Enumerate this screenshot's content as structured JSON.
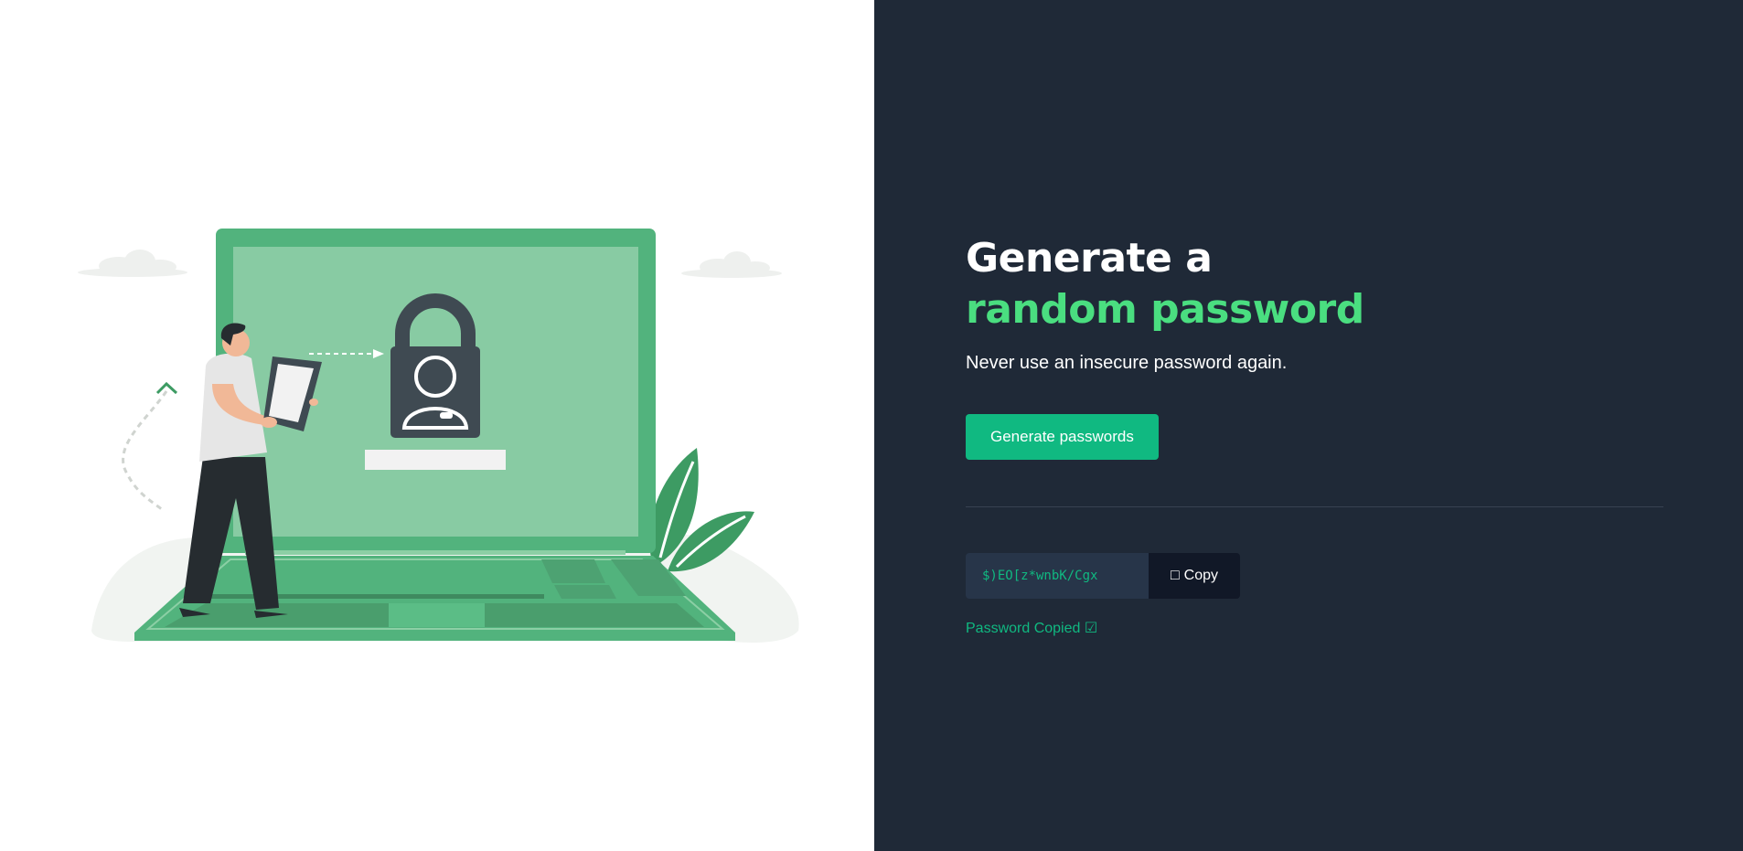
{
  "hero": {
    "title_line1": "Generate a",
    "title_line2": "random password",
    "subtitle": "Never use an insecure password again.",
    "generate_button_label": "Generate passwords"
  },
  "password": {
    "value": "$)EO[z*wnbK/Cgx",
    "copy_icon": "□",
    "copy_label": "Copy",
    "status": "Password Copied ☑"
  },
  "colors": {
    "panel_dark": "#1f2937",
    "accent_green": "#4ade80",
    "button_green": "#10b981",
    "output_bg": "#273549",
    "copy_bg": "#111827"
  },
  "illustration": {
    "name": "person-with-tablet-laptop-lock-illustration"
  }
}
